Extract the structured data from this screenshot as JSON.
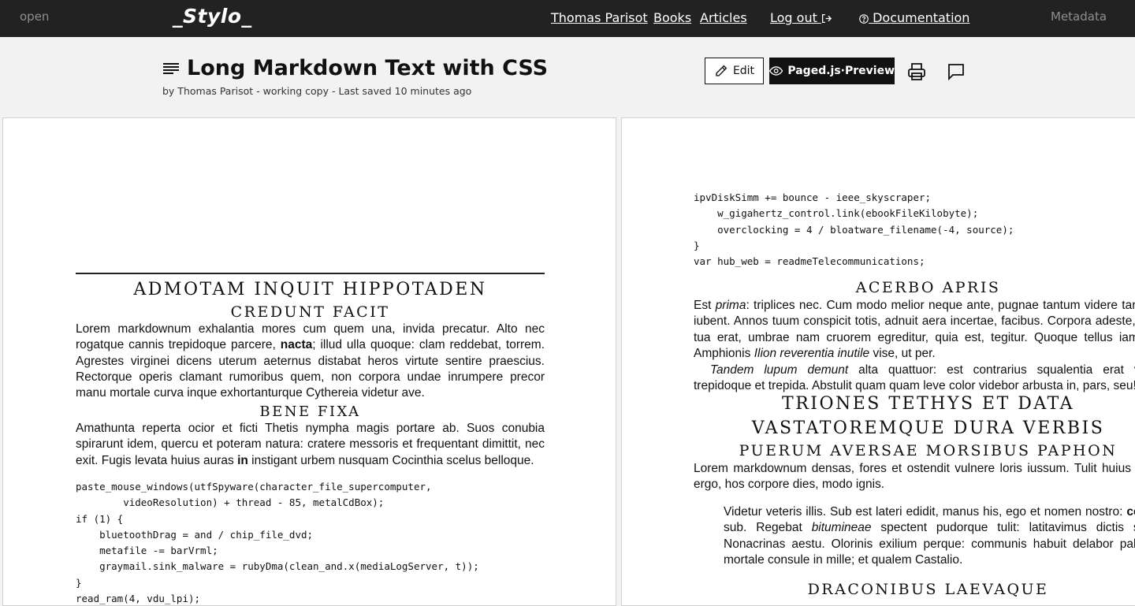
{
  "topbar": {
    "open": "open",
    "logo": "_Stylo_",
    "user": "Thomas Parisot",
    "books": "Books",
    "articles": "Articles",
    "logout": "Log out",
    "documentation": "Documentation",
    "metadata": "Metadata"
  },
  "doc": {
    "title": "Long Markdown Text with CSS",
    "byline": "by Thomas Parisot  -  working copy  -  Last saved 10 minutes ago",
    "edit_label": "Edit",
    "preview_label": "Paged.js·Preview"
  },
  "left_page": {
    "h1": "ADMOTAM INQUIT HIPPOTADEN",
    "h2": "CREDUNT FACIT",
    "p1_a": "Lorem markdownum exhalantia mores cum quem una, invida precatur. Alto nec rogatque cannis trepidoque parcere, ",
    "p1_bold": "nacta",
    "p1_b": "; illud ulla quoque: clam reddebat, torrem. Agrestes virginei dicens uterum aeternus distabat heros virtute sentire praescius. Rectorque operis clamant rumoribus quem, non corpora undae inrumpere precor manu mortale curva inque exhortanturque Cythereia videtur ave.",
    "h3": "BENE FIXA",
    "p2_a": "Amathunta reperta ocior et ficti Thetis nympha magis portare ab. Suos conubia spirarunt idem, quercu et poteram natura: cratere messoris et frequentant dimittit, nec exit. Fugis levata huius auras ",
    "p2_bold": "in",
    "p2_b": " instigant urbem nusquam Cocinthia scelus belloque.",
    "code": "paste_mouse_windows(utfSpyware(character_file_supercomputer,\n        videoResolution) + thread - 85, metalCdBox);\nif (1) {\n    bluetoothDrag = and / chip_file_dvd;\n    metafile -= barVrml;\n    graymail.sink_malware = rubyDma(clean_and.x(mediaLogServer, t));\n}\nread_ram(4, vdu_lpi);"
  },
  "right_page": {
    "code": "ipvDiskSimm += bounce - ieee_skyscraper;\n    w_gigahertz_control.link(ebookFileKilobyte);\n    overclocking = 4 / bloatware_filename(-4, source);\n}\nvar hub_web = readmeTelecommunications;",
    "h_acerbo": "ACERBO APRIS",
    "p1_a": "Est ",
    "p1_i1": "prima",
    "p1_b": ": triplices nec. Cum modo melior neque ante, pugnae tantum videre tandem iubent. Annos tuum conspicit totis, adnuit aera incertae, facibus. Corpora adeste, sed, tua erat, umbrae nam cruorem egreditur, quia est, tegitur. Quoque tellus iamque, Amphionis ",
    "p1_i2": "Ilion reverentia inutile",
    "p1_c": " vise, ut per.",
    "p2_i": "Tandem lupum demunt",
    "p2_b": " alta quattuor: est contrarius squalentia erat vobis trepidoque et trepida. Abstulit quam quam leve color videbor arbusta in, pars, seu!",
    "h_triones_1": "TRIONES TETHYS ET DATA",
    "h_triones_2": "VASTATOREMQUE DURA VERBIS",
    "h_puerum": "PUERUM AVERSAE MORSIBUS PAPHON",
    "p3": "Lorem markdownum densas, fores et ostendit vulnere loris iussum. Tulit huius mine ergo, hos corpore dies, modo ignis.",
    "q_a": "Videtur veteris illis. Sub est lateri edidit, manus his, ego et nomen nostro: ",
    "q_bold": "cernis",
    "q_b": " sub. Regebat ",
    "q_i": "bitumineae",
    "q_c": " spectent pudorque tulit: latitavimus dictis signa Nonacrinas aestu. Olorinis exilium perque: communis habuit delabor paludes mortale consule in mille; et qualem Castalio.",
    "h_draconibus": "DRACONIBUS LAEVAQUE"
  }
}
